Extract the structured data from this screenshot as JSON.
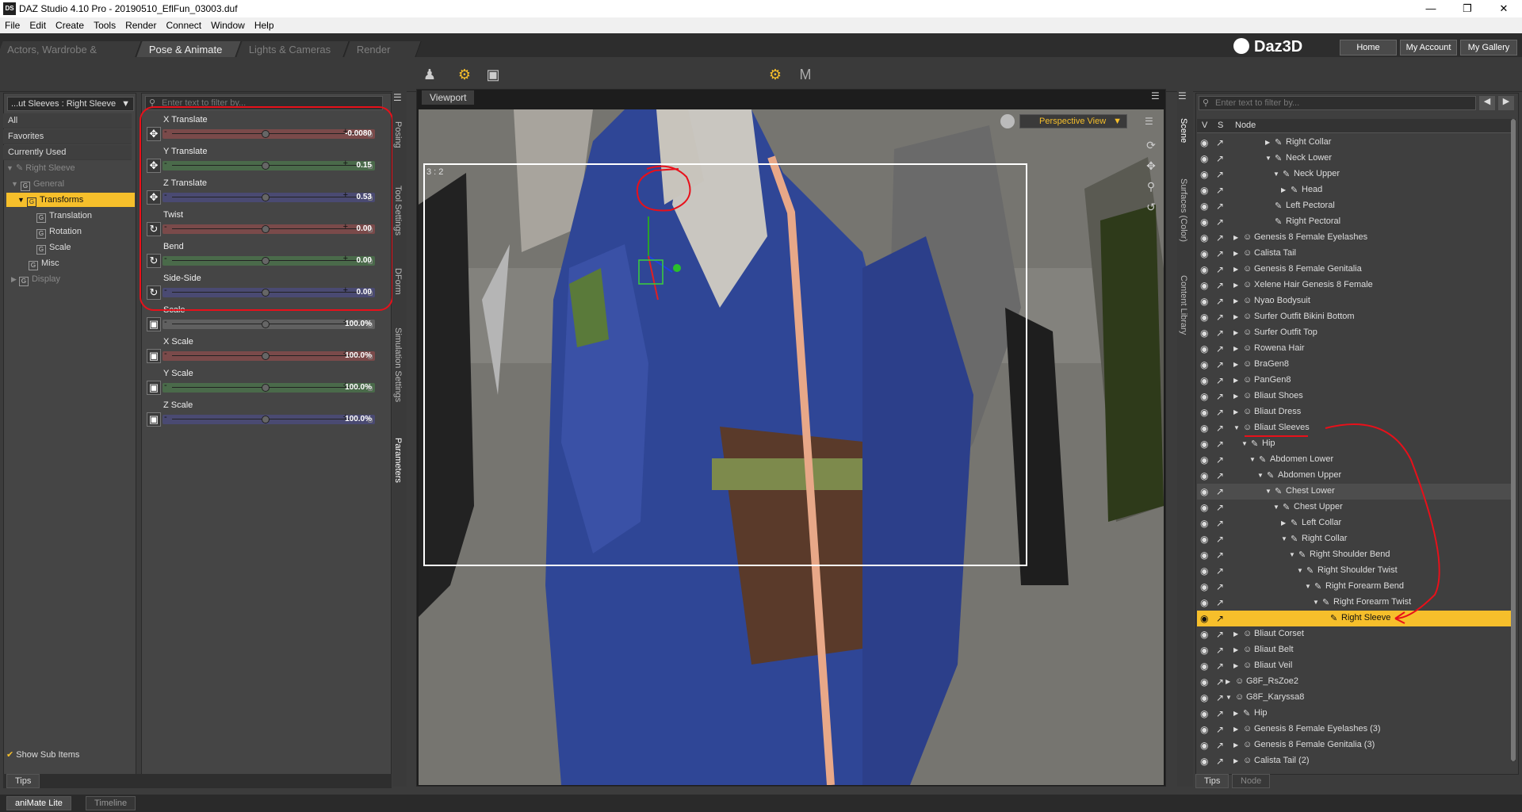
{
  "title_bar": {
    "app_icon": "DS",
    "title": "DAZ Studio 4.10 Pro - 20190510_EflFun_03003.duf"
  },
  "menu": [
    "File",
    "Edit",
    "Create",
    "Tools",
    "Render",
    "Connect",
    "Window",
    "Help"
  ],
  "room_tabs": [
    "Actors, Wardrobe & Props",
    "Pose & Animate",
    "Lights & Cameras",
    "Render"
  ],
  "brand": {
    "name": "Daz3D",
    "home": "Home",
    "account": "My Account",
    "gallery": "My Gallery"
  },
  "left_panel": {
    "dropdown": "...ut Sleeves : Right Sleeve",
    "filters": [
      "All",
      "Favorites",
      "Currently Used"
    ],
    "tree": [
      {
        "label": "Right Sleeve"
      },
      {
        "label": "General"
      },
      {
        "label": "Transforms"
      },
      {
        "label": "Translation"
      },
      {
        "label": "Rotation"
      },
      {
        "label": "Scale"
      },
      {
        "label": "Misc"
      },
      {
        "label": "Display"
      }
    ],
    "show_sub_items": "Show Sub Items",
    "tips": "Tips"
  },
  "params": {
    "filter_placeholder": "Enter text to filter by...",
    "sliders": [
      {
        "label": "X Translate",
        "value": "-0.0080",
        "color": "#7a4a4a",
        "knob": 0.5,
        "icon": "move-icon"
      },
      {
        "label": "Y Translate",
        "value": "0.15",
        "color": "#4a6a4a",
        "knob": 0.5,
        "icon": "move-icon"
      },
      {
        "label": "Z Translate",
        "value": "0.53",
        "color": "#4a4a72",
        "knob": 0.5,
        "icon": "move-icon"
      },
      {
        "label": "Twist",
        "value": "0.00",
        "color": "#7a4a4a",
        "knob": 0.5,
        "icon": "rotate-icon"
      },
      {
        "label": "Bend",
        "value": "0.00",
        "color": "#4a6a4a",
        "knob": 0.5,
        "icon": "rotate-icon"
      },
      {
        "label": "Side-Side",
        "value": "0.00",
        "color": "#4a4a72",
        "knob": 0.5,
        "icon": "rotate-icon"
      },
      {
        "label": "Scale",
        "value": "100.0%",
        "color": "#606060",
        "knob": 0.5,
        "icon": "scale-icon"
      },
      {
        "label": "X Scale",
        "value": "100.0%",
        "color": "#7a4a4a",
        "knob": 0.5,
        "icon": "scale-icon"
      },
      {
        "label": "Y Scale",
        "value": "100.0%",
        "color": "#4a6a4a",
        "knob": 0.5,
        "icon": "scale-icon"
      },
      {
        "label": "Z Scale",
        "value": "100.0%",
        "color": "#4a4a72",
        "knob": 0.5,
        "icon": "scale-icon"
      }
    ],
    "side_tabs": [
      "Posing",
      "Tool Settings",
      "DForm",
      "Simulation Settings",
      "Parameters"
    ]
  },
  "viewport": {
    "tab": "Viewport",
    "view_mode": "Perspective View",
    "aspect": "3 : 2"
  },
  "scene": {
    "filter_placeholder": "Enter text to filter by...",
    "headers": [
      "V",
      "S",
      "Node"
    ],
    "side_tabs": [
      "Scene",
      "Surfaces (Color)",
      "Content Library"
    ],
    "rows": [
      {
        "label": "Right Collar",
        "indent": 4,
        "type": "bone",
        "arrow": "▶"
      },
      {
        "label": "Neck Lower",
        "indent": 4,
        "type": "bone",
        "arrow": "▼"
      },
      {
        "label": "Neck Upper",
        "indent": 5,
        "type": "bone",
        "arrow": "▼"
      },
      {
        "label": "Head",
        "indent": 6,
        "type": "bone",
        "arrow": "▶"
      },
      {
        "label": "Left Pectoral",
        "indent": 4,
        "type": "bone",
        "arrow": ""
      },
      {
        "label": "Right Pectoral",
        "indent": 4,
        "type": "bone",
        "arrow": ""
      },
      {
        "label": "Genesis 8 Female Eyelashes",
        "indent": 0,
        "type": "figure",
        "arrow": "▶"
      },
      {
        "label": "Calista Tail",
        "indent": 0,
        "type": "figure",
        "arrow": "▶"
      },
      {
        "label": "Genesis 8 Female Genitalia",
        "indent": 0,
        "type": "figure",
        "arrow": "▶"
      },
      {
        "label": "Xelene Hair Genesis 8 Female",
        "indent": 0,
        "type": "figure",
        "arrow": "▶"
      },
      {
        "label": "Nyao Bodysuit",
        "indent": 0,
        "type": "figure",
        "arrow": "▶"
      },
      {
        "label": "Surfer Outfit Bikini Bottom",
        "indent": 0,
        "type": "figure",
        "arrow": "▶"
      },
      {
        "label": "Surfer Outfit Top",
        "indent": 0,
        "type": "figure",
        "arrow": "▶"
      },
      {
        "label": "Rowena Hair",
        "indent": 0,
        "type": "figure",
        "arrow": "▶"
      },
      {
        "label": "BraGen8",
        "indent": 0,
        "type": "figure",
        "arrow": "▶"
      },
      {
        "label": "PanGen8",
        "indent": 0,
        "type": "figure",
        "arrow": "▶"
      },
      {
        "label": "Bliaut Shoes",
        "indent": 0,
        "type": "figure",
        "arrow": "▶"
      },
      {
        "label": "Bliaut Dress",
        "indent": 0,
        "type": "figure",
        "arrow": "▶"
      },
      {
        "label": "Bliaut Sleeves",
        "indent": 0,
        "type": "figure",
        "arrow": "▼"
      },
      {
        "label": "Hip",
        "indent": 1,
        "type": "bone",
        "arrow": "▼"
      },
      {
        "label": "Abdomen Lower",
        "indent": 2,
        "type": "bone",
        "arrow": "▼"
      },
      {
        "label": "Abdomen Upper",
        "indent": 3,
        "type": "bone",
        "arrow": "▼"
      },
      {
        "label": "Chest Lower",
        "indent": 4,
        "type": "bone",
        "arrow": "▼"
      },
      {
        "label": "Chest Upper",
        "indent": 5,
        "type": "bone",
        "arrow": "▼"
      },
      {
        "label": "Left Collar",
        "indent": 6,
        "type": "bone",
        "arrow": "▶"
      },
      {
        "label": "Right Collar",
        "indent": 6,
        "type": "bone",
        "arrow": "▼"
      },
      {
        "label": "Right Shoulder Bend",
        "indent": 7,
        "type": "bone",
        "arrow": "▼"
      },
      {
        "label": "Right Shoulder Twist",
        "indent": 8,
        "type": "bone",
        "arrow": "▼"
      },
      {
        "label": "Right Forearm Bend",
        "indent": 9,
        "type": "bone",
        "arrow": "▼"
      },
      {
        "label": "Right Forearm Twist",
        "indent": 10,
        "type": "bone",
        "arrow": "▼"
      },
      {
        "label": "Right Sleeve",
        "indent": 11,
        "type": "bone",
        "arrow": ""
      },
      {
        "label": "Bliaut Corset",
        "indent": 0,
        "type": "figure",
        "arrow": "▶"
      },
      {
        "label": "Bliaut Belt",
        "indent": 0,
        "type": "figure",
        "arrow": "▶"
      },
      {
        "label": "Bliaut Veil",
        "indent": 0,
        "type": "figure",
        "arrow": "▶"
      },
      {
        "label": "G8F_RsZoe2",
        "indent": -1,
        "type": "figure",
        "arrow": "▶"
      },
      {
        "label": "G8F_Karyssa8",
        "indent": -1,
        "type": "figure",
        "arrow": "▼"
      },
      {
        "label": "Hip",
        "indent": 0,
        "type": "bone",
        "arrow": "▶"
      },
      {
        "label": "Genesis 8 Female Eyelashes (3)",
        "indent": 0,
        "type": "figure",
        "arrow": "▶"
      },
      {
        "label": "Genesis 8 Female Genitalia (3)",
        "indent": 0,
        "type": "figure",
        "arrow": "▶"
      },
      {
        "label": "Calista Tail (2)",
        "indent": 0,
        "type": "figure",
        "arrow": "▶"
      }
    ],
    "bottom_tabs": [
      "Tips",
      "Node"
    ]
  },
  "bottom_bar": [
    "aniMate Lite",
    "Timeline"
  ],
  "colors": {
    "accent": "#f6bf2b",
    "annotation": "#e8101a"
  }
}
